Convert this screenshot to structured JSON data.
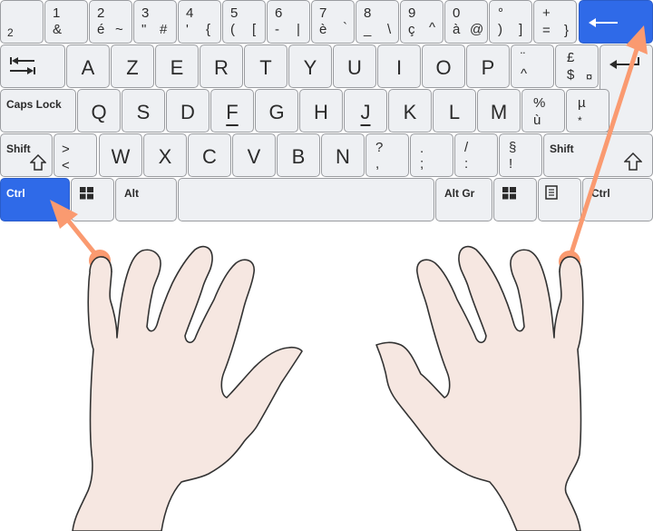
{
  "keyboard": {
    "layout": "AZERTY",
    "colors": {
      "key_bg": "#eef0f3",
      "key_border": "#9a9ca0",
      "highlight": "#2f6ae8",
      "arrow": "#fa9a70",
      "hand_fill": "#f6e7e1",
      "hand_stroke": "#333333"
    },
    "row1": [
      {
        "bl": "2"
      },
      {
        "tl": "1",
        "bl": "&"
      },
      {
        "tl": "2",
        "bl": "é",
        "br": "~"
      },
      {
        "tl": "3",
        "bl": "\"",
        "br": "#"
      },
      {
        "tl": "4",
        "bl": "'",
        "br": "{"
      },
      {
        "tl": "5",
        "bl": "(",
        "br": "["
      },
      {
        "tl": "6",
        "bl": "-",
        "br": "|"
      },
      {
        "tl": "7",
        "bl": "è",
        "br": "`"
      },
      {
        "tl": "8",
        "bl": "_",
        "br": "\\"
      },
      {
        "tl": "9",
        "bl": "ç",
        "br": "^"
      },
      {
        "tl": "0",
        "bl": "à",
        "br": "@"
      },
      {
        "tl": "°",
        "bl": ")",
        "br": "]"
      },
      {
        "tl": "+",
        "bl": "=",
        "br": "}"
      }
    ],
    "backspace": {
      "icon": "backspace-arrow-icon",
      "highlighted": true
    },
    "row2": [
      {
        "icon": "tab-icon"
      },
      {
        "main": "A"
      },
      {
        "main": "Z"
      },
      {
        "main": "E"
      },
      {
        "main": "R"
      },
      {
        "main": "T"
      },
      {
        "main": "Y"
      },
      {
        "main": "U"
      },
      {
        "main": "I"
      },
      {
        "main": "O"
      },
      {
        "main": "P"
      },
      {
        "tl": "¨",
        "bl": "^"
      },
      {
        "tl": "£",
        "bl": "$",
        "br": "¤"
      }
    ],
    "enter": {
      "icon": "enter-icon"
    },
    "row3": [
      {
        "label": "Caps Lock"
      },
      {
        "main": "Q"
      },
      {
        "main": "S"
      },
      {
        "main": "D"
      },
      {
        "main": "F",
        "homing": true
      },
      {
        "main": "G"
      },
      {
        "main": "H"
      },
      {
        "main": "J",
        "homing": true
      },
      {
        "main": "K"
      },
      {
        "main": "L"
      },
      {
        "main": "M"
      },
      {
        "tl": "%",
        "bl": "ù"
      },
      {
        "tl": "µ",
        "bl": "*"
      }
    ],
    "row4": [
      {
        "label": "Shift"
      },
      {
        "tl": ">",
        "bl": "<"
      },
      {
        "main": "W"
      },
      {
        "main": "X"
      },
      {
        "main": "C"
      },
      {
        "main": "V"
      },
      {
        "main": "B"
      },
      {
        "main": "N"
      },
      {
        "tl": "?",
        "bl": ","
      },
      {
        "tl": ".",
        "bl": ";"
      },
      {
        "tl": "/",
        "bl": ":"
      },
      {
        "tl": "§",
        "bl": "!"
      },
      {
        "label": "Shift"
      }
    ],
    "row5": [
      {
        "label": "Ctrl",
        "highlighted": true
      },
      {
        "icon": "windows-icon"
      },
      {
        "label": "Alt"
      },
      {
        "label": ""
      },
      {
        "label": "Alt Gr"
      },
      {
        "icon": "windows-icon"
      },
      {
        "icon": "menu-icon"
      },
      {
        "label": "Ctrl"
      }
    ]
  },
  "annotation": {
    "left_hand_pinky_to": "Ctrl",
    "right_hand_pinky_to": "Backspace"
  }
}
